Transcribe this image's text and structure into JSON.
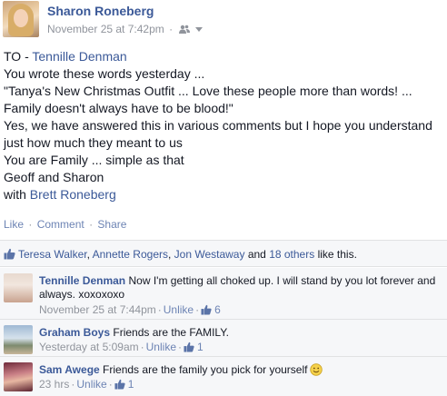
{
  "post": {
    "author": "Sharon Roneberg",
    "timestamp": "November 25 at 7:42pm",
    "separator": "·",
    "audience_icon": "friends-icon",
    "body": {
      "to_prefix": "TO - ",
      "to_name": "Tennille Denman",
      "line2": "You wrote these words yesterday ...",
      "line3": "\"Tanya's New Christmas Outfit ... Love these people more than words! ...",
      "line4": "Family doesn't always have to be blood!\"",
      "line5": "Yes, we have answered this in various comments but I hope you understand",
      "line6": "just how much they meant to us",
      "line7": "You are Family ... simple as that",
      "line8": "Geoff and Sharon",
      "with_prefix": "with ",
      "with_name": "Brett Roneberg"
    }
  },
  "actions": {
    "like": "Like",
    "comment": "Comment",
    "share": "Share",
    "dot": "·"
  },
  "likes": {
    "icon": "thumbs-up-icon",
    "name1": "Teresa Walker",
    "comma1": ", ",
    "name2": "Annette Rogers",
    "comma2": ", ",
    "name3": "Jon Westaway",
    "and": " and ",
    "others": "18 others",
    "suffix": " like this."
  },
  "comments": [
    {
      "author": "Tennille Denman",
      "text": "Now I'm getting all choked up. I will stand by you lot forever and always. xoxoxoxo",
      "time": "November 25 at 7:44pm",
      "unlike": "Unlike",
      "like_count": "6"
    },
    {
      "author": "Graham Boys",
      "text": "Friends are the FAMILY.",
      "time": "Yesterday at 5:09am",
      "unlike": "Unlike",
      "like_count": "1"
    },
    {
      "author": "Sam Awege",
      "text": "Friends are the family you pick for yourself",
      "emoji_icon": "smile-icon",
      "time": "23 hrs",
      "unlike": "Unlike",
      "like_count": "1"
    }
  ],
  "colors": {
    "link": "#3b5998",
    "meta": "#90949c",
    "panel": "#f6f7f9"
  }
}
